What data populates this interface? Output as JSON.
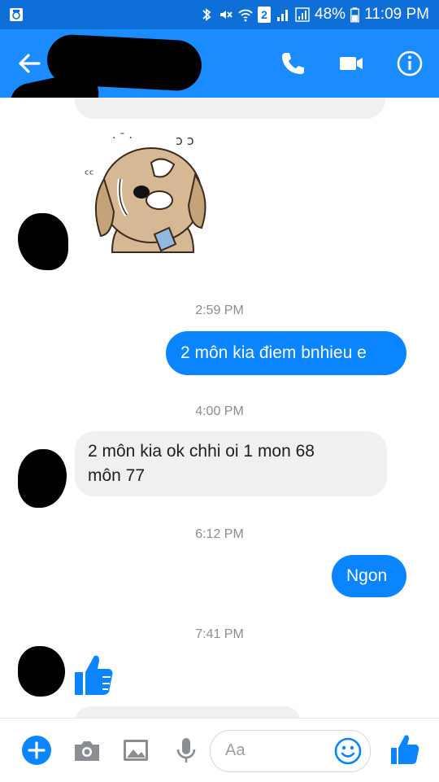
{
  "status_bar": {
    "battery": "48%",
    "time": "11:09 PM",
    "sim": "2",
    "icons": [
      "android-icon",
      "bluetooth-icon",
      "mute-icon",
      "wifi-icon",
      "sim-icon",
      "signal-icon",
      "signal-icon",
      "battery-icon"
    ]
  },
  "header": {
    "icons": [
      "back-arrow-icon",
      "phone-icon",
      "video-icon",
      "info-icon"
    ],
    "accent": "#1a8cff"
  },
  "messages": [
    {
      "type": "sticker",
      "direction": "in",
      "icon": "crying-dog-sticker"
    },
    {
      "type": "timestamp",
      "text": "2:59 PM"
    },
    {
      "type": "text",
      "direction": "out",
      "text": "2 môn kia điem bnhieu e"
    },
    {
      "type": "timestamp",
      "text": "4:00 PM"
    },
    {
      "type": "text",
      "direction": "in",
      "lines": [
        "2 môn kia ok chhi oi 1 mon 68",
        "môn 77"
      ]
    },
    {
      "type": "timestamp",
      "text": "6:12 PM"
    },
    {
      "type": "text",
      "direction": "out",
      "text": "Ngon"
    },
    {
      "type": "timestamp",
      "text": "7:41 PM"
    },
    {
      "type": "like",
      "direction": "in",
      "icon": "thumbs-up-icon"
    }
  ],
  "composer": {
    "placeholder": "Aa",
    "icons": [
      "plus-icon",
      "camera-icon",
      "image-icon",
      "microphone-icon",
      "emoji-icon",
      "thumbs-up-icon"
    ]
  },
  "colors": {
    "outgoing_bubble": "#0a84ff",
    "incoming_bubble": "#f1f0f0",
    "timestamp": "#8a8d91"
  }
}
